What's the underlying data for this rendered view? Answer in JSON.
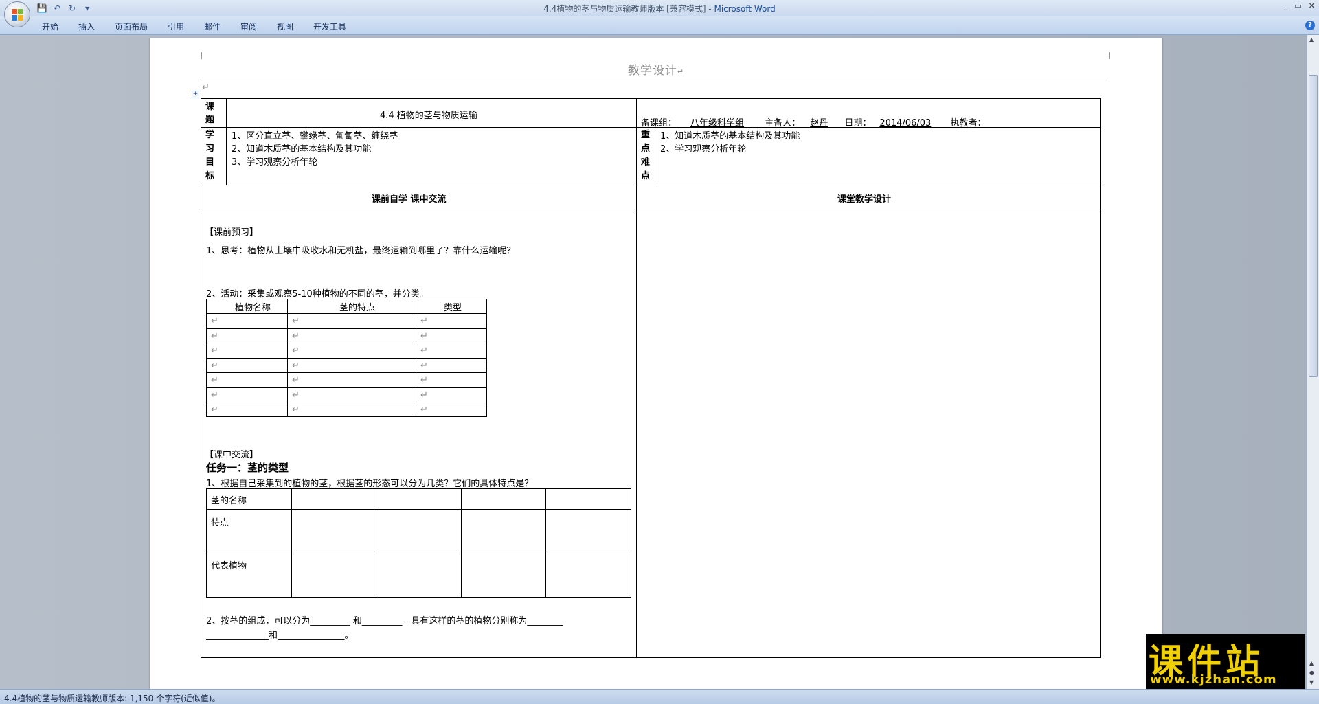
{
  "window": {
    "title_prefix": "4.4植物的茎与物质运输教师版本 [兼容模式] - ",
    "app_name": "Microsoft Word",
    "min": "_",
    "restore": "▭",
    "close": "✕"
  },
  "qat": {
    "save_icon": "💾",
    "undo_icon": "↶",
    "redo_icon": "↻",
    "more": "▾"
  },
  "ribbon": {
    "tabs": [
      "开始",
      "插入",
      "页面布局",
      "引用",
      "邮件",
      "审阅",
      "视图",
      "开发工具"
    ],
    "help": "?"
  },
  "doc": {
    "header_title": "教学设计",
    "mark": "↵",
    "topic_label": "课题",
    "topic": "4.4 植物的茎与物质运输",
    "meta": {
      "group_label": "备课组：",
      "group": "八年级科学组",
      "preparer_label": "主备人：",
      "preparer": "赵丹",
      "date_label": "日期：",
      "date": "2014/06/03",
      "teacher_label": "执教者：",
      "teacher": ""
    },
    "goals_label": "学习目标",
    "goals": [
      "1、区分直立茎、攀缘茎、匍匐茎、缠绕茎",
      "2、知道木质茎的基本结构及其功能",
      "3、学习观察分析年轮"
    ],
    "key_label": "重点难点",
    "keys": [
      "1、知道木质茎的基本结构及其功能",
      "2、学习观察分析年轮"
    ],
    "left_header": "课前自学    课中交流",
    "right_header": "课堂教学设计",
    "preview_title": "【课前预习】",
    "q1": "1、思考：植物从土壤中吸收水和无机盐，最终运输到哪里了？靠什么运输呢？",
    "q2": "2、活动：采集或观察5-10种植物的不同的茎，并分类。",
    "table1_headers": [
      "植物名称",
      "茎的特点",
      "类型"
    ],
    "exchange_title": "【课中交流】",
    "task1": "任务一：茎的类型",
    "task1_q": "1、根据自己采集到的植物的茎，根据茎的形态可以分为几类？它们的具体特点是？",
    "table2_rows": [
      "茎的名称",
      "特点",
      "代表植物"
    ],
    "q3_line1": "2、按茎的组成，可以分为_________ 和_________。具有这样的茎的植物分别称为________",
    "q3_line2": "______________和_______________。"
  },
  "status": {
    "text": "4.4植物的茎与物质运输教师版本: 1,150 个字符(近似值)。"
  },
  "watermark": {
    "big": "课件站",
    "small": "www.kjzhan.com"
  }
}
